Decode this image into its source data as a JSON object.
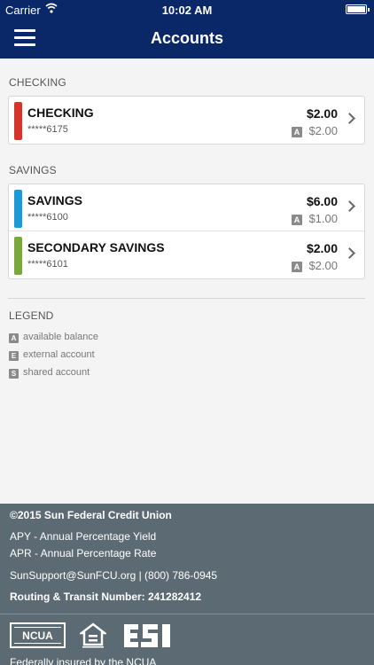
{
  "status_bar": {
    "carrier": "Carrier",
    "time": "10:02 AM"
  },
  "nav": {
    "title": "Accounts"
  },
  "checking": {
    "section_title": "CHECKING",
    "accounts": [
      {
        "name": "CHECKING",
        "number": "*****6175",
        "balance": "$2.00",
        "available": "$2.00",
        "badge": "A",
        "color": "#d6342a"
      }
    ]
  },
  "savings": {
    "section_title": "SAVINGS",
    "accounts": [
      {
        "name": "SAVINGS",
        "number": "*****6100",
        "balance": "$6.00",
        "available": "$1.00",
        "badge": "A",
        "color": "#1a9ad6"
      },
      {
        "name": "SECONDARY SAVINGS",
        "number": "*****6101",
        "balance": "$2.00",
        "available": "$2.00",
        "badge": "A",
        "color": "#7aa83a"
      }
    ]
  },
  "legend": {
    "title": "LEGEND",
    "items": [
      {
        "badge": "A",
        "label": "available balance"
      },
      {
        "badge": "E",
        "label": "external account"
      },
      {
        "badge": "S",
        "label": "shared account"
      }
    ]
  },
  "footer": {
    "copyright": "©2015 Sun Federal Credit Union",
    "apy": "APY - Annual Percentage Yield",
    "apr": "APR - Annual Percentage Rate",
    "contact": "SunSupport@SunFCU.org | (800) 786-0945",
    "routing": "Routing & Transit Number: 241282412",
    "ncua_logo": "NCUA",
    "insured": "Federally insured by the NCUA"
  },
  "colors": {
    "nav_bg": "#0a2868",
    "footer_bg": "#5c6a73",
    "badge_bg": "#8a8a8a"
  }
}
